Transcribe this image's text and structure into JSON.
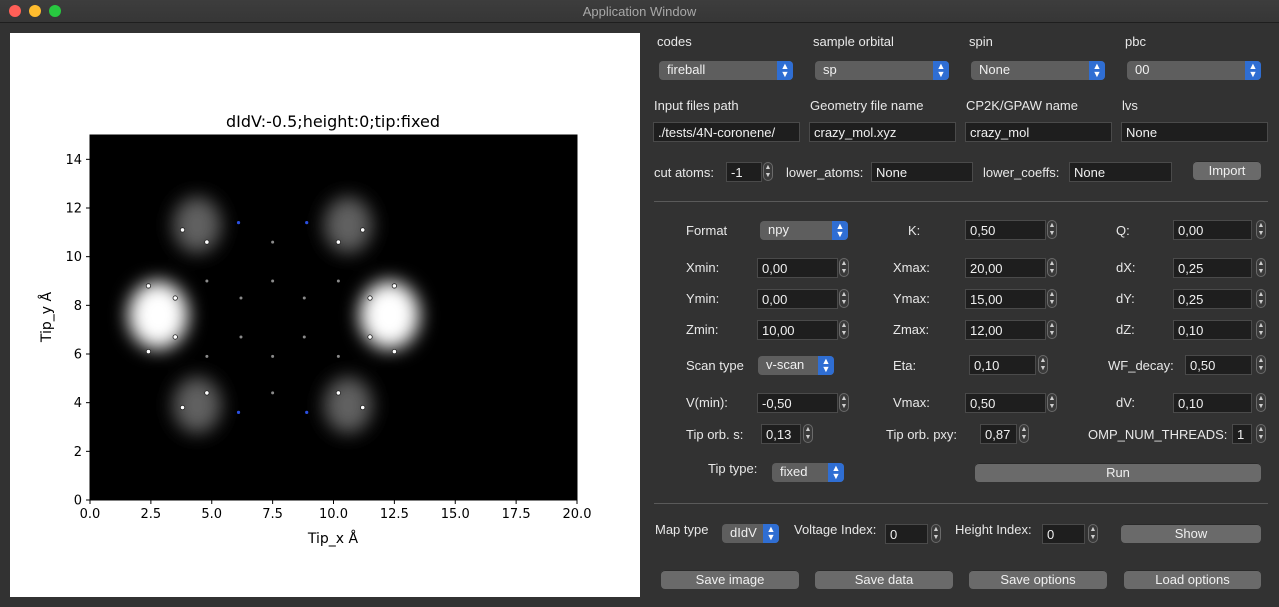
{
  "window": {
    "title": "Application Window"
  },
  "plot": {
    "title": "dIdV:-0.5;height:0;tip:fixed",
    "xlabel": "Tip_x Å",
    "ylabel": "Tip_y Å",
    "xticks": [
      "0.0",
      "2.5",
      "5.0",
      "7.5",
      "10.0",
      "12.5",
      "15.0",
      "17.5",
      "20.0"
    ],
    "yticks": [
      "0",
      "2",
      "4",
      "6",
      "8",
      "10",
      "12",
      "14"
    ]
  },
  "chart_data": {
    "type": "heatmap",
    "title": "dIdV:-0.5;height:0;tip:fixed",
    "xlabel": "Tip_x Å",
    "ylabel": "Tip_y Å",
    "xlim": [
      0,
      20
    ],
    "ylim": [
      0,
      15
    ],
    "colormap": "gray",
    "blobs": [
      {
        "x": 2.8,
        "y": 7.6,
        "intensity": 1.0
      },
      {
        "x": 12.3,
        "y": 7.6,
        "intensity": 1.0
      },
      {
        "x": 4.4,
        "y": 11.3,
        "intensity": 0.38
      },
      {
        "x": 10.6,
        "y": 11.3,
        "intensity": 0.38
      },
      {
        "x": 4.4,
        "y": 3.9,
        "intensity": 0.38
      },
      {
        "x": 10.6,
        "y": 3.9,
        "intensity": 0.38
      }
    ],
    "atoms_outer": [
      {
        "x": 3.8,
        "y": 11.1
      },
      {
        "x": 4.8,
        "y": 10.6
      },
      {
        "x": 10.2,
        "y": 10.6
      },
      {
        "x": 11.2,
        "y": 11.1
      },
      {
        "x": 2.4,
        "y": 8.8
      },
      {
        "x": 3.5,
        "y": 8.3
      },
      {
        "x": 11.5,
        "y": 8.3
      },
      {
        "x": 12.5,
        "y": 8.8
      },
      {
        "x": 2.4,
        "y": 6.1
      },
      {
        "x": 3.5,
        "y": 6.7
      },
      {
        "x": 11.5,
        "y": 6.7
      },
      {
        "x": 12.5,
        "y": 6.1
      },
      {
        "x": 3.8,
        "y": 3.8
      },
      {
        "x": 4.8,
        "y": 4.4
      },
      {
        "x": 10.2,
        "y": 4.4
      },
      {
        "x": 11.2,
        "y": 3.8
      }
    ],
    "atoms_inner": [
      {
        "x": 7.5,
        "y": 10.6
      },
      {
        "x": 4.8,
        "y": 9.0
      },
      {
        "x": 7.5,
        "y": 9.0
      },
      {
        "x": 10.2,
        "y": 9.0
      },
      {
        "x": 6.2,
        "y": 8.3
      },
      {
        "x": 8.8,
        "y": 8.3
      },
      {
        "x": 6.2,
        "y": 6.7
      },
      {
        "x": 8.8,
        "y": 6.7
      },
      {
        "x": 4.8,
        "y": 5.9
      },
      {
        "x": 7.5,
        "y": 5.9
      },
      {
        "x": 10.2,
        "y": 5.9
      },
      {
        "x": 7.5,
        "y": 4.4
      }
    ],
    "atoms_nitrogen": [
      {
        "x": 6.1,
        "y": 11.4
      },
      {
        "x": 8.9,
        "y": 11.4
      },
      {
        "x": 6.1,
        "y": 3.6
      },
      {
        "x": 8.9,
        "y": 3.6
      }
    ]
  },
  "top": {
    "codes": {
      "label": "codes",
      "value": "fireball"
    },
    "sample_orbital": {
      "label": "sample orbital",
      "value": "sp"
    },
    "spin": {
      "label": "spin",
      "value": "None"
    },
    "pbc": {
      "label": "pbc",
      "value": "00"
    },
    "input_path": {
      "label": "Input files path",
      "value": "./tests/4N-coronene/"
    },
    "geometry": {
      "label": "Geometry file name",
      "value": "crazy_mol.xyz"
    },
    "cp2k": {
      "label": "CP2K/GPAW name",
      "value": "crazy_mol"
    },
    "lvs": {
      "label": "lvs",
      "value": "None"
    },
    "cut_atoms": {
      "label": "cut atoms:",
      "value": "-1"
    },
    "lower_atoms": {
      "label": "lower_atoms:",
      "value": "None"
    },
    "lower_coeffs": {
      "label": "lower_coeffs:",
      "value": "None"
    },
    "import_label": "Import"
  },
  "params": {
    "format": {
      "label": "Format",
      "value": "npy"
    },
    "K": {
      "label": "K:",
      "value": "0,50"
    },
    "Q": {
      "label": "Q:",
      "value": "0,00"
    },
    "xmin": {
      "label": "Xmin:",
      "value": "0,00"
    },
    "xmax": {
      "label": "Xmax:",
      "value": "20,00"
    },
    "dx": {
      "label": "dX:",
      "value": "0,25"
    },
    "ymin": {
      "label": "Ymin:",
      "value": "0,00"
    },
    "ymax": {
      "label": "Ymax:",
      "value": "15,00"
    },
    "dy": {
      "label": "dY:",
      "value": "0,25"
    },
    "zmin": {
      "label": "Zmin:",
      "value": "10,00"
    },
    "zmax": {
      "label": "Zmax:",
      "value": "12,00"
    },
    "dz": {
      "label": "dZ:",
      "value": "0,10"
    },
    "scan_type": {
      "label": "Scan type",
      "value": "v-scan"
    },
    "eta": {
      "label": "Eta:",
      "value": "0,10"
    },
    "wf_decay": {
      "label": "WF_decay:",
      "value": "0,50"
    },
    "vmin": {
      "label": "V(min):",
      "value": "-0,50"
    },
    "vmax": {
      "label": "Vmax:",
      "value": "0,50"
    },
    "dv": {
      "label": "dV:",
      "value": "0,10"
    },
    "tip_s": {
      "label": "Tip orb. s:",
      "value": "0,13"
    },
    "tip_pxy": {
      "label": "Tip orb. pxy:",
      "value": "0,87"
    },
    "omp": {
      "label": "OMP_NUM_THREADS:",
      "value": "1"
    },
    "tip_type": {
      "label": "Tip type:",
      "value": "fixed"
    },
    "run_label": "Run"
  },
  "bottom": {
    "map_type": {
      "label": "Map type",
      "value": "dIdV"
    },
    "voltage_index": {
      "label": "Voltage Index:",
      "value": "0"
    },
    "height_index": {
      "label": "Height Index:",
      "value": "0"
    },
    "show_label": "Show",
    "save_image": "Save image",
    "save_data": "Save data",
    "save_options": "Save options",
    "load_options": "Load options"
  }
}
